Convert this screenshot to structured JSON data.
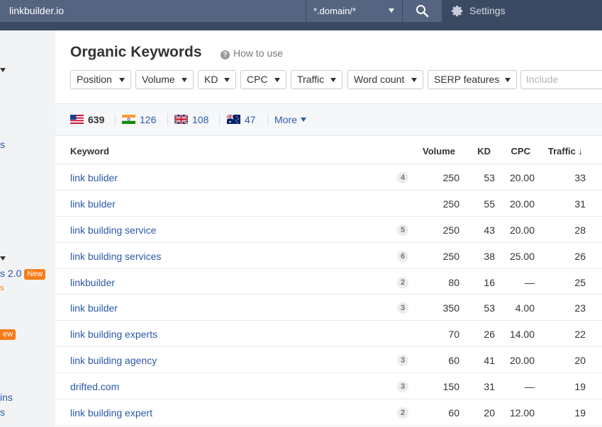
{
  "topbar": {
    "domain_value": "linkbuilder.io",
    "mode_value": "*.domain/*",
    "settings_label": "Settings"
  },
  "sidebar": {
    "fragments": [
      "s",
      "s 2.0",
      "s",
      "ew",
      "ins",
      "s"
    ],
    "new_badge": "New"
  },
  "page": {
    "title": "Organic Keywords",
    "how_to_use": "How to use"
  },
  "filters": [
    "Position",
    "Volume",
    "KD",
    "CPC",
    "Traffic",
    "Word count",
    "SERP features"
  ],
  "include_placeholder": "Include",
  "countries": [
    {
      "flag": "us-flag",
      "count": "639"
    },
    {
      "flag": "in-flag",
      "count": "126"
    },
    {
      "flag": "gb-flag",
      "count": "108"
    },
    {
      "flag": "au-flag",
      "count": "47"
    }
  ],
  "more_label": "More",
  "table": {
    "headers": {
      "keyword": "Keyword",
      "volume": "Volume",
      "kd": "KD",
      "cpc": "CPC",
      "traffic": "Traffic ↓"
    },
    "rows": [
      {
        "keyword": "link bulider",
        "position": "4",
        "volume": "250",
        "kd": "53",
        "cpc": "20.00",
        "traffic": "33"
      },
      {
        "keyword": "link bulder",
        "position": "",
        "volume": "250",
        "kd": "55",
        "cpc": "20.00",
        "traffic": "31"
      },
      {
        "keyword": "link building service",
        "position": "5",
        "volume": "250",
        "kd": "43",
        "cpc": "20.00",
        "traffic": "28"
      },
      {
        "keyword": "link building services",
        "position": "6",
        "volume": "250",
        "kd": "38",
        "cpc": "25.00",
        "traffic": "26"
      },
      {
        "keyword": "linkbuilder",
        "position": "2",
        "volume": "80",
        "kd": "16",
        "cpc": "—",
        "traffic": "25"
      },
      {
        "keyword": "link builder",
        "position": "3",
        "volume": "350",
        "kd": "53",
        "cpc": "4.00",
        "traffic": "23"
      },
      {
        "keyword": "link building experts",
        "position": "",
        "volume": "70",
        "kd": "26",
        "cpc": "14.00",
        "traffic": "22"
      },
      {
        "keyword": "link building agency",
        "position": "3",
        "volume": "60",
        "kd": "41",
        "cpc": "20.00",
        "traffic": "20"
      },
      {
        "keyword": "drifted.com",
        "position": "3",
        "volume": "150",
        "kd": "31",
        "cpc": "—",
        "traffic": "19"
      },
      {
        "keyword": "link building expert",
        "position": "2",
        "volume": "60",
        "kd": "20",
        "cpc": "12.00",
        "traffic": "19"
      }
    ]
  },
  "colors": {
    "topbar": "#3b4a63",
    "link": "#2a59a8",
    "badge": "#f57c17"
  }
}
